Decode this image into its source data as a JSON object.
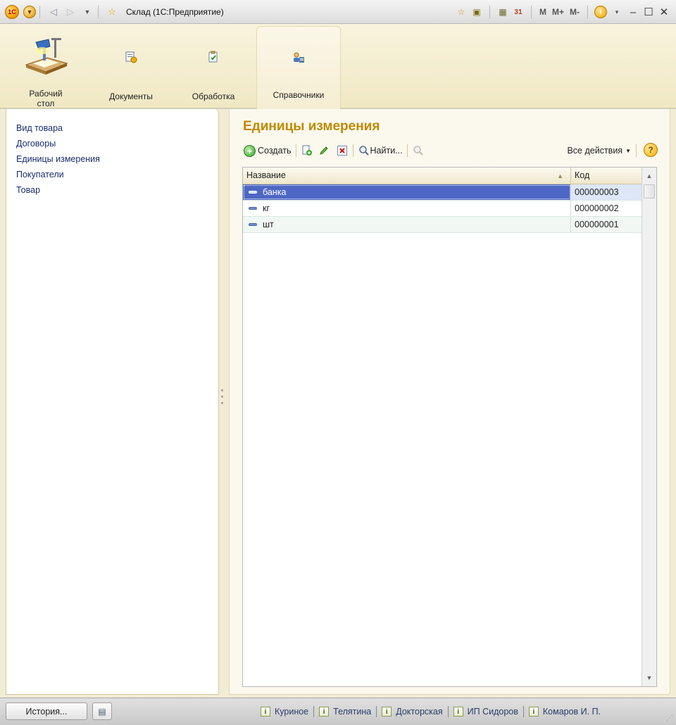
{
  "window": {
    "title": "Склад  (1С:Предприятие)",
    "right_buttons": [
      "M",
      "M+",
      "M-"
    ]
  },
  "sections": [
    {
      "label": "Рабочий стол",
      "icon": "desk-lamp-icon",
      "active": false
    },
    {
      "label": "Документы",
      "icon": "documents-icon",
      "active": false
    },
    {
      "label": "Обработка",
      "icon": "processing-icon",
      "active": false
    },
    {
      "label": "Справочники",
      "icon": "catalogs-icon",
      "active": true
    }
  ],
  "nav": {
    "items": [
      "Вид товара",
      "Договоры",
      "Единицы измерения",
      "Покупатели",
      "Товар"
    ]
  },
  "form": {
    "title": "Единицы измерения",
    "toolbar": {
      "create_label": "Создать",
      "find_label": "Найти...",
      "all_actions_label": "Все действия"
    },
    "table": {
      "columns": [
        "Название",
        "Код"
      ],
      "rows": [
        {
          "name": "банка",
          "code": "000000003",
          "selected": true
        },
        {
          "name": "кг",
          "code": "000000002",
          "selected": false
        },
        {
          "name": "шт",
          "code": "000000001",
          "selected": false
        }
      ]
    }
  },
  "status": {
    "history_label": "История...",
    "recent": [
      "Куриное",
      "Телятина",
      "Докторская",
      "ИП Сидоров",
      "Комаров И. П."
    ]
  },
  "colors": {
    "accent_title": "#bf8a00",
    "selection": "#4e67c4",
    "nav_link": "#1a2c6e"
  }
}
